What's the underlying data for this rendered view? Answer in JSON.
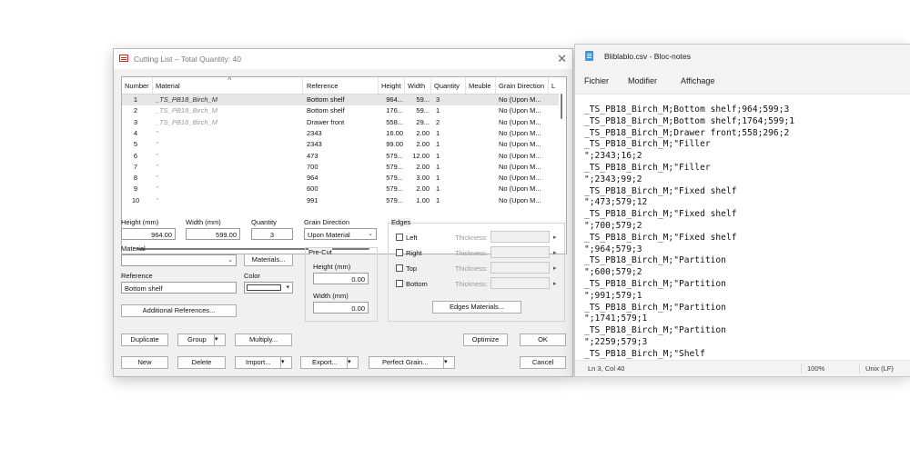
{
  "cutting_list": {
    "title": "Cutting List – Total Quantity: 40",
    "columns": [
      "Number",
      "Material",
      "Reference",
      "Height",
      "Width",
      "Quantity",
      "Meuble",
      "Grain Direction",
      "L"
    ],
    "rows": [
      {
        "number": "1",
        "material": "_TS_PB18_Birch_M",
        "reference": "Bottom shelf",
        "height": "964...",
        "width": "59...",
        "quantity": "3",
        "meuble": "",
        "grain": "No (Upon M..."
      },
      {
        "number": "2",
        "material": "_TS_PB18_Birch_M",
        "reference": "Bottom shelf",
        "height": "176...",
        "width": "59...",
        "quantity": "1",
        "meuble": "",
        "grain": "No (Upon M..."
      },
      {
        "number": "3",
        "material": "_TS_PB18_Birch_M",
        "reference": "Drawer front",
        "height": "558...",
        "width": "29...",
        "quantity": "2",
        "meuble": "",
        "grain": "No (Upon M..."
      },
      {
        "number": "4",
        "material": "\"",
        "reference": "2343",
        "height": "16.00",
        "width": "2.00",
        "quantity": "1",
        "meuble": "",
        "grain": "No (Upon M..."
      },
      {
        "number": "5",
        "material": "\"",
        "reference": "2343",
        "height": "99.00",
        "width": "2.00",
        "quantity": "1",
        "meuble": "",
        "grain": "No (Upon M..."
      },
      {
        "number": "6",
        "material": "\"",
        "reference": "473",
        "height": "579...",
        "width": "12.00",
        "quantity": "1",
        "meuble": "",
        "grain": "No (Upon M..."
      },
      {
        "number": "7",
        "material": "\"",
        "reference": "700",
        "height": "579...",
        "width": "2.00",
        "quantity": "1",
        "meuble": "",
        "grain": "No (Upon M..."
      },
      {
        "number": "8",
        "material": "\"",
        "reference": "964",
        "height": "579...",
        "width": "3.00",
        "quantity": "1",
        "meuble": "",
        "grain": "No (Upon M..."
      },
      {
        "number": "9",
        "material": "\"",
        "reference": "600",
        "height": "579...",
        "width": "2.00",
        "quantity": "1",
        "meuble": "",
        "grain": "No (Upon M..."
      },
      {
        "number": "10",
        "material": "\"",
        "reference": "991",
        "height": "579...",
        "width": "1.00",
        "quantity": "1",
        "meuble": "",
        "grain": "No (Upon M..."
      }
    ],
    "form": {
      "height_label": "Height (mm)",
      "height_value": "964.00",
      "width_label": "Width (mm)",
      "width_value": "599.00",
      "quantity_label": "Quantity",
      "quantity_value": "3",
      "grain_label": "Grain Direction",
      "grain_value": "Upon Material",
      "material_label": "Material",
      "material_value": "",
      "materials_button": "Materials...",
      "color_label": "Color",
      "reference_label": "Reference",
      "reference_value": "Bottom shelf",
      "additional_refs_button": "Additional References...",
      "precut_label": "Pre-Cut",
      "precut_height_label": "Height (mm)",
      "precut_height_value": "0.00",
      "precut_width_label": "Width (mm)",
      "precut_width_value": "0.00",
      "edges_label": "Edges",
      "edges": [
        {
          "label": "Left",
          "thickness_label": "Thickness:"
        },
        {
          "label": "Right",
          "thickness_label": "Thickness:"
        },
        {
          "label": "Top",
          "thickness_label": "Thickness:"
        },
        {
          "label": "Bottom",
          "thickness_label": "Thickness:"
        }
      ],
      "edges_materials_button": "Edges Materials..."
    },
    "buttons": {
      "duplicate": "Duplicate",
      "group": "Group",
      "multiply": "Multiply...",
      "optimize": "Optimize",
      "ok": "OK",
      "new": "New",
      "delete": "Delete",
      "import": "Import...",
      "export": "Export...",
      "perfect_grain": "Perfect Grain...",
      "cancel": "Cancel"
    }
  },
  "notepad": {
    "title": "Bliblablo.csv - Bloc-notes",
    "menu": [
      "Fichier",
      "Modifier",
      "Affichage"
    ],
    "lines": [
      "_TS_PB18_Birch_M;Bottom shelf;964;599;3",
      "_TS_PB18_Birch_M;Bottom shelf;1764;599;1",
      "_TS_PB18_Birch_M;Drawer front;558;296;2",
      "_TS_PB18_Birch_M;\"Filler",
      "\";2343;16;2",
      "_TS_PB18_Birch_M;\"Filler",
      "\";2343;99;2",
      "_TS_PB18_Birch_M;\"Fixed shelf",
      "\";473;579;12",
      "_TS_PB18_Birch_M;\"Fixed shelf",
      "\";700;579;2",
      "_TS_PB18_Birch_M;\"Fixed shelf",
      "\";964;579;3",
      "_TS_PB18_Birch_M;\"Partition",
      "\";600;579;2",
      "_TS_PB18_Birch_M;\"Partition",
      "\";991;579;1",
      "_TS_PB18_Birch_M;\"Partition",
      "\";1741;579;1",
      "_TS_PB18_Birch_M;\"Partition",
      "\";2259;579;3",
      "_TS_PB18_Birch_M;\"Shelf"
    ],
    "status": {
      "position": "Ln 3, Col 40",
      "zoom": "100%",
      "line_ending": "Unix (LF)"
    }
  }
}
